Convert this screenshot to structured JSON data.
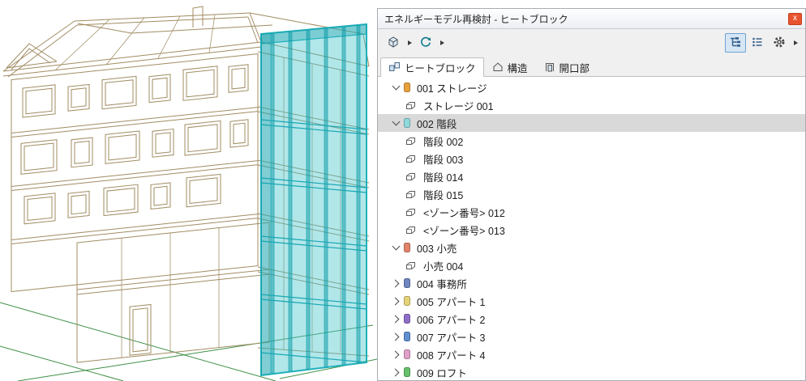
{
  "window": {
    "title": "エネルギーモデル再検討 - ヒートブロック",
    "close_label": "x"
  },
  "tabs": [
    {
      "label": "ヒートブロック",
      "icon": "heat-block-icon",
      "active": true
    },
    {
      "label": "構造",
      "icon": "structure-house-icon",
      "active": false
    },
    {
      "label": "開口部",
      "icon": "opening-door-icon",
      "active": false
    }
  ],
  "toolbar": {
    "left_icons": [
      "3d-model-icon",
      "refresh-icon"
    ],
    "right_icons": [
      "tree-view-icon",
      "flat-list-view-icon",
      "gear-icon"
    ],
    "active_view": "tree-view"
  },
  "tree": {
    "items": [
      {
        "type": "group",
        "expanded": true,
        "label": "001 ストレージ",
        "color": "#e8a23c"
      },
      {
        "type": "child",
        "label": "ストレージ  001"
      },
      {
        "type": "group",
        "expanded": true,
        "label": "002 階段",
        "color": "#8fd9dc",
        "selected": true
      },
      {
        "type": "child",
        "label": "階段 002"
      },
      {
        "type": "child",
        "label": "階段 003"
      },
      {
        "type": "child",
        "label": "階段 014"
      },
      {
        "type": "child",
        "label": "階段 015"
      },
      {
        "type": "child",
        "label": "<ゾーン番号> 012"
      },
      {
        "type": "child",
        "label": "<ゾーン番号> 013"
      },
      {
        "type": "group",
        "expanded": true,
        "label": "003 小売",
        "color": "#e2836a"
      },
      {
        "type": "child",
        "label": "小売 004"
      },
      {
        "type": "group",
        "expanded": false,
        "label": "004 事務所",
        "color": "#6f86c0"
      },
      {
        "type": "group",
        "expanded": false,
        "label": "005 アパート 1",
        "color": "#e5d47a"
      },
      {
        "type": "group",
        "expanded": false,
        "label": "006 アパート 2",
        "color": "#8e6fc8"
      },
      {
        "type": "group",
        "expanded": false,
        "label": "007 アパート 3",
        "color": "#5f8fd0"
      },
      {
        "type": "group",
        "expanded": false,
        "label": "008 アパート 4",
        "color": "#e0a0c8"
      },
      {
        "type": "group",
        "expanded": false,
        "label": "009 ロフト",
        "color": "#66c06a"
      }
    ]
  },
  "colors": {
    "panel_bg": "#f0f0f0",
    "selection_bg": "#d9d9d9",
    "close_button_bg": "#e8542f",
    "active_view_button_bg": "#d6e6f5",
    "active_view_button_border": "#6da3d4",
    "highlight_teal": "#2bb6c0",
    "wireframe_line": "#a08c62",
    "site_line_green": "#3f8f46"
  }
}
